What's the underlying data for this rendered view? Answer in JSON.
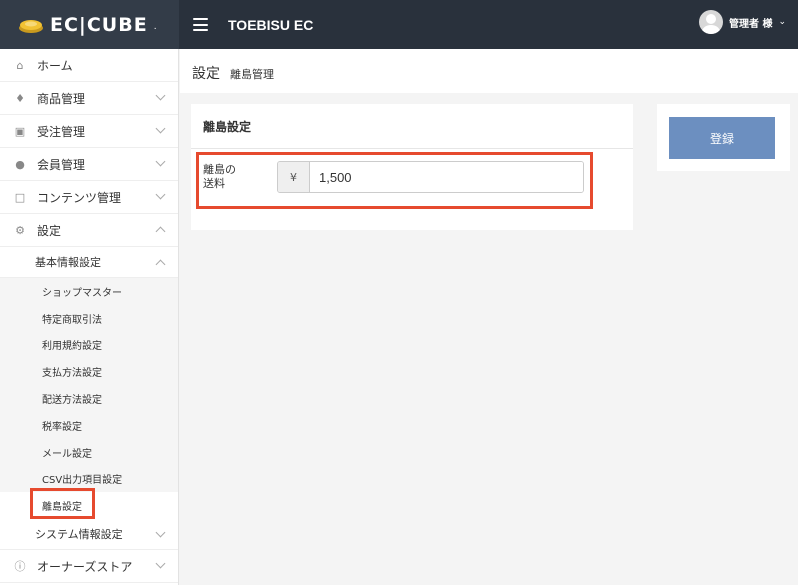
{
  "brand": {
    "logo_text": "EC|CUBE",
    "logo_mark": "."
  },
  "header": {
    "shop_name": "TOEBISU EC",
    "user_label": "管理者 様"
  },
  "sidebar": {
    "items": [
      {
        "label": "ホーム",
        "icon": "home-icon"
      },
      {
        "label": "商品管理",
        "icon": "tag-icon"
      },
      {
        "label": "受注管理",
        "icon": "cart-icon"
      },
      {
        "label": "会員管理",
        "icon": "users-icon"
      },
      {
        "label": "コンテンツ管理",
        "icon": "file-icon"
      },
      {
        "label": "設定",
        "icon": "gear-icon"
      }
    ],
    "settings_sub": {
      "label": "基本情報設定"
    },
    "basic_items": [
      "ショップマスター",
      "特定商取引法",
      "利用規約設定",
      "支払方法設定",
      "配送方法設定",
      "税率設定",
      "メール設定",
      "CSV出力項目設定",
      "離島設定"
    ],
    "system_sub": {
      "label": "システム情報設定"
    },
    "owners": {
      "label": "オーナーズストア",
      "icon": "info-icon"
    }
  },
  "page": {
    "title": "設定",
    "subtitle": "離島管理"
  },
  "card": {
    "title": "離島設定",
    "field_label": "離島の\n送料",
    "currency": "¥",
    "value": "1,500"
  },
  "actions": {
    "register_label": "登録"
  },
  "colors": {
    "accent": "#6c8fc0",
    "highlight": "#e64a2e",
    "header": "#29313c"
  }
}
